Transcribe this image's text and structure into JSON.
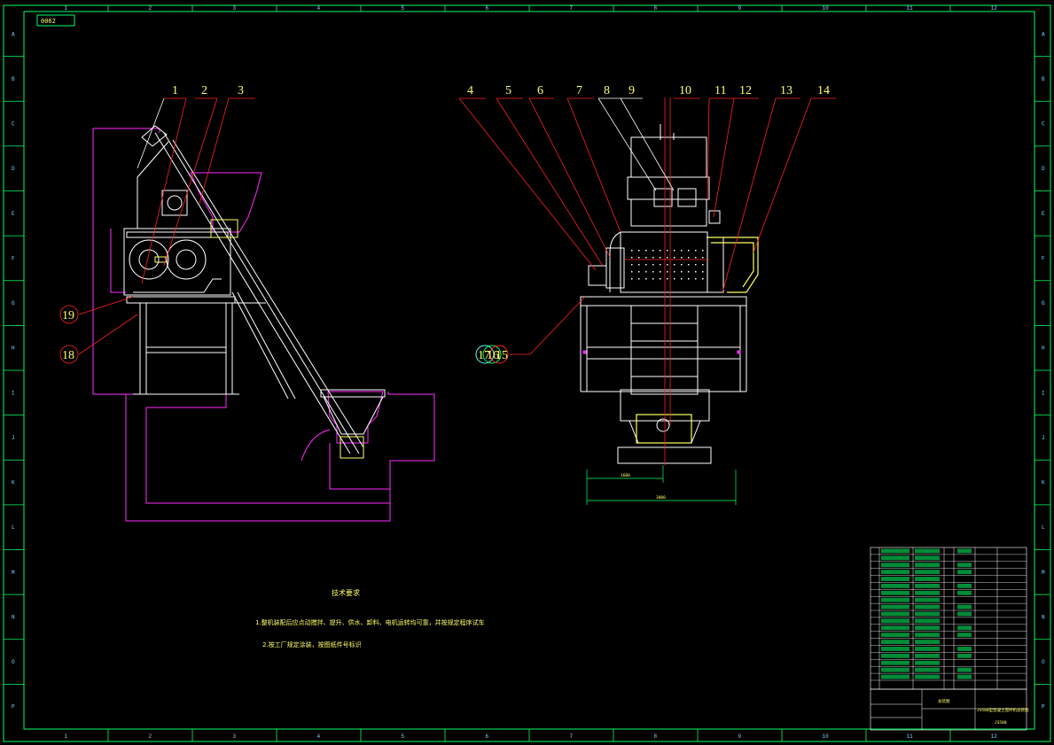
{
  "drawing_number": "0062",
  "border_grid": {
    "top": [
      "1",
      "2",
      "3",
      "4",
      "5",
      "6",
      "7",
      "8",
      "9",
      "10",
      "11",
      "12"
    ],
    "bottom": [
      "1",
      "2",
      "3",
      "4",
      "5",
      "6",
      "7",
      "8",
      "9",
      "10",
      "11",
      "12"
    ],
    "left": [
      "A",
      "B",
      "C",
      "D",
      "E",
      "F",
      "G",
      "H",
      "I",
      "J",
      "K",
      "L",
      "M",
      "N",
      "O",
      "P"
    ],
    "right": [
      "A",
      "B",
      "C",
      "D",
      "E",
      "F",
      "G",
      "H",
      "I",
      "J",
      "K",
      "L",
      "M",
      "N",
      "O",
      "P"
    ]
  },
  "side_view": {
    "callouts_top": [
      "1",
      "2",
      "3"
    ],
    "callouts_circled": [
      "19",
      "18"
    ]
  },
  "front_view": {
    "callouts_top": [
      "4",
      "5",
      "6",
      "7",
      "8",
      "9",
      "10",
      "11",
      "12",
      "13",
      "14"
    ],
    "callouts_circled": [
      "17",
      "16",
      "15"
    ],
    "dim_inner": "1600",
    "dim_outer": "3000"
  },
  "technical_requirements": {
    "title": "技术要求",
    "lines": [
      "1.整机装配后应点动搅拌、提升、供水、卸料、电机运转均可靠，并按规定程序试车",
      "2.按工厂规定涂装，按图纸件号标识"
    ]
  },
  "title_block": {
    "assembly_label": "总装图",
    "title": "JS500型混凝土搅拌机总装图",
    "code": "JS500"
  },
  "colors": {
    "frame": "#00ff66",
    "white": "#ffffff",
    "callout_red": "#ff2020",
    "magenta": "#ff2cff",
    "yellow": "#ffff66",
    "cyan": "#66ffff"
  }
}
